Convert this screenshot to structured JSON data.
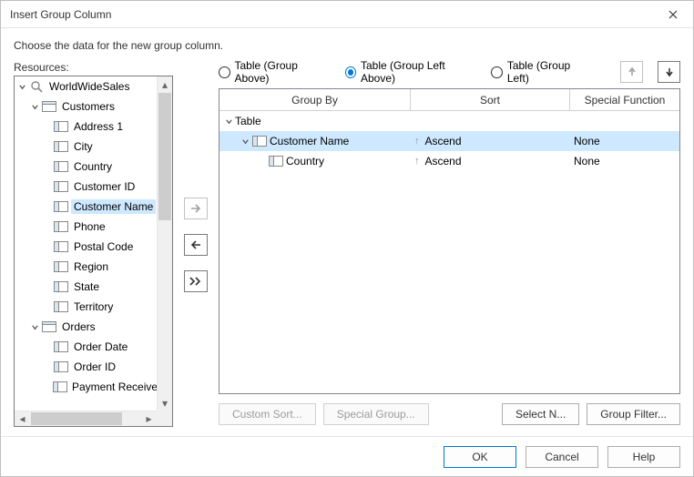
{
  "title": "Insert Group Column",
  "instruction": "Choose the data for the new group column.",
  "resources_label": "Resources:",
  "tree": {
    "root": "WorldWideSales",
    "customers": "Customers",
    "customers_children": [
      "Address 1",
      "City",
      "Country",
      "Customer ID",
      "Customer Name",
      "Phone",
      "Postal Code",
      "Region",
      "State",
      "Territory"
    ],
    "selected": "Customer Name",
    "orders": "Orders",
    "orders_children": [
      "Order Date",
      "Order ID",
      "Payment Received"
    ]
  },
  "radios": {
    "above": "Table (Group Above)",
    "left_above": "Table (Group Left Above)",
    "left": "Table (Group Left)",
    "selected": "left_above"
  },
  "grid": {
    "headers": {
      "group_by": "Group By",
      "sort": "Sort",
      "func": "Special Function"
    },
    "rows": [
      {
        "indent": 0,
        "caret": "down",
        "icon": null,
        "label": "Table",
        "sort": "",
        "func": ""
      },
      {
        "indent": 1,
        "caret": "down",
        "icon": "field",
        "label": "Customer Name",
        "sort": "Ascend",
        "func": "None",
        "selected": true
      },
      {
        "indent": 2,
        "caret": null,
        "icon": "field",
        "label": "Country",
        "sort": "Ascend",
        "func": "None"
      }
    ]
  },
  "buttons": {
    "custom_sort": "Custom Sort...",
    "special_group": "Special Group...",
    "select_n": "Select N...",
    "group_filter": "Group Filter..."
  },
  "footer": {
    "ok": "OK",
    "cancel": "Cancel",
    "help": "Help"
  }
}
